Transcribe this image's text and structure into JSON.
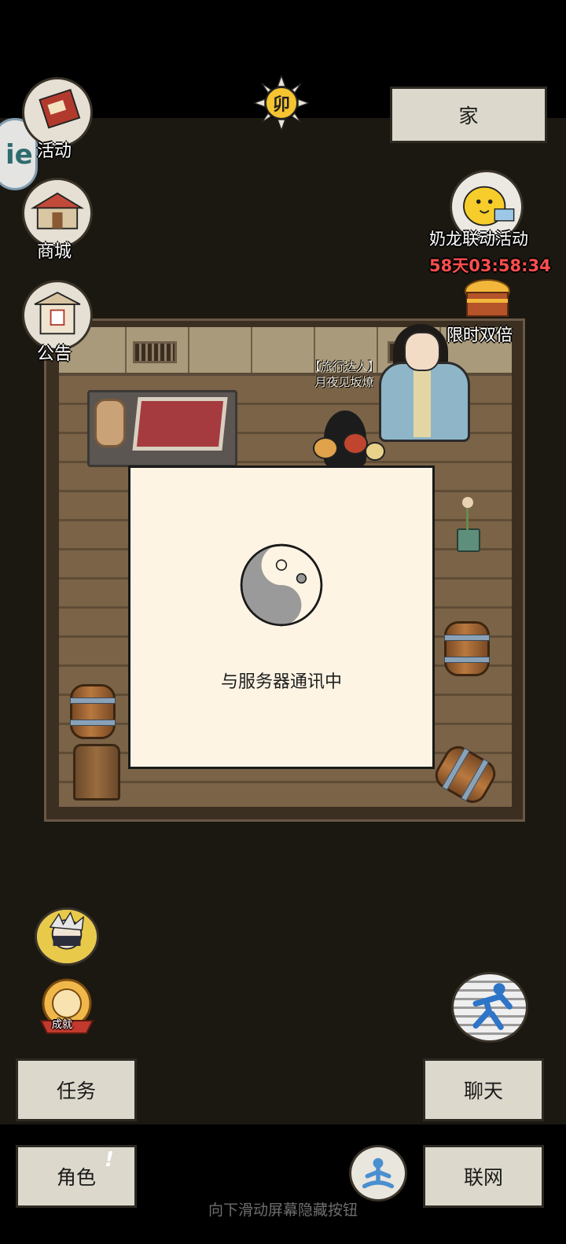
{
  "hud": {
    "activity_label": "活动",
    "shop_label": "商城",
    "notice_label": "公告",
    "home_button": "家",
    "side_tab_glyph": "ie",
    "sun_glyph": "卯",
    "event_name": "奶龙联动活动",
    "event_timer": "58天03:58:34",
    "double_label": "限时双倍",
    "achievement_label": "成就"
  },
  "npc": {
    "title": "【旅行达人】",
    "name": "月夜见坂燎"
  },
  "loading": {
    "message": "与服务器通讯中"
  },
  "bottom": {
    "task_button": "任务",
    "role_button": "角色",
    "role_alert": "!",
    "chat_button": "聊天",
    "network_button": "联网",
    "hint": "向下滑动屏幕隐藏按钮"
  },
  "icons": [
    "flag-icon",
    "shop-icon",
    "notice-icon",
    "sun-icon",
    "event-mascot-icon",
    "treasure-chest-icon",
    "ninja-avatar-icon",
    "achievement-medal-icon",
    "running-icon",
    "meditation-icon",
    "taiji-icon"
  ],
  "colors": {
    "timer": "#ff4d4d",
    "button_bg": "#dcd8cc",
    "dialog_bg": "#fdf4e4"
  }
}
